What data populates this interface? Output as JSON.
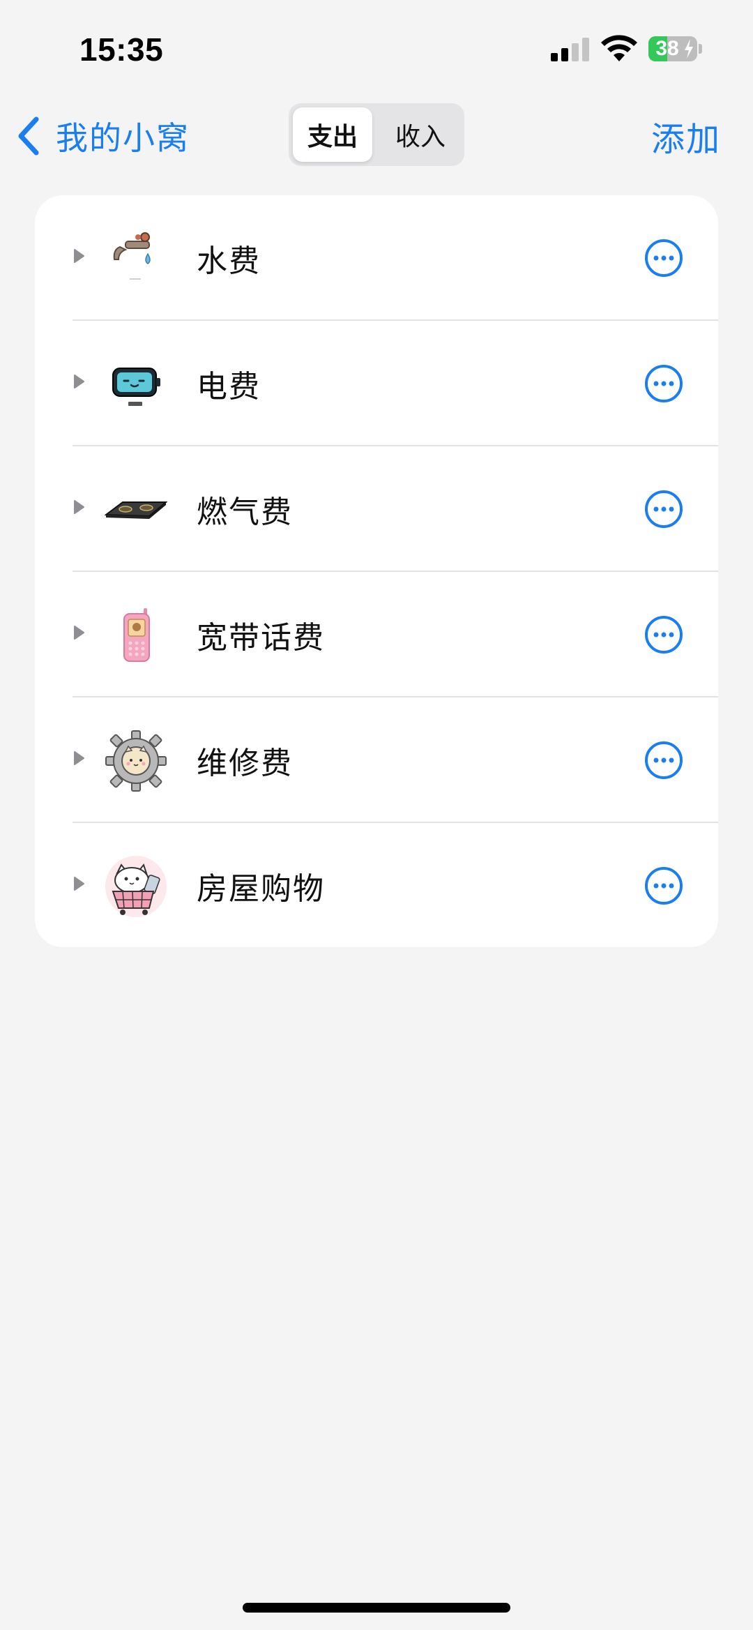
{
  "status_bar": {
    "time": "15:35",
    "battery_level": "38",
    "battery_fraction": 0.38,
    "icons": [
      "cellular-signal-icon",
      "wifi-icon",
      "battery-charging-icon"
    ]
  },
  "nav": {
    "back_label": "我的小窝",
    "segments": [
      {
        "label": "支出",
        "selected": true
      },
      {
        "label": "收入",
        "selected": false
      }
    ],
    "add_label": "添加"
  },
  "categories": [
    {
      "label": "水费",
      "icon": "faucet-icon"
    },
    {
      "label": "电费",
      "icon": "battery-face-icon"
    },
    {
      "label": "燃气费",
      "icon": "gas-stove-icon"
    },
    {
      "label": "宽带话费",
      "icon": "pink-phone-icon"
    },
    {
      "label": "维修费",
      "icon": "gear-cat-icon"
    },
    {
      "label": "房屋购物",
      "icon": "cat-shopping-cart-icon"
    }
  ],
  "colors": {
    "accent": "#1a7ef0",
    "background": "#f4f4f5",
    "card": "#ffffff",
    "battery_green": "#34c759"
  }
}
